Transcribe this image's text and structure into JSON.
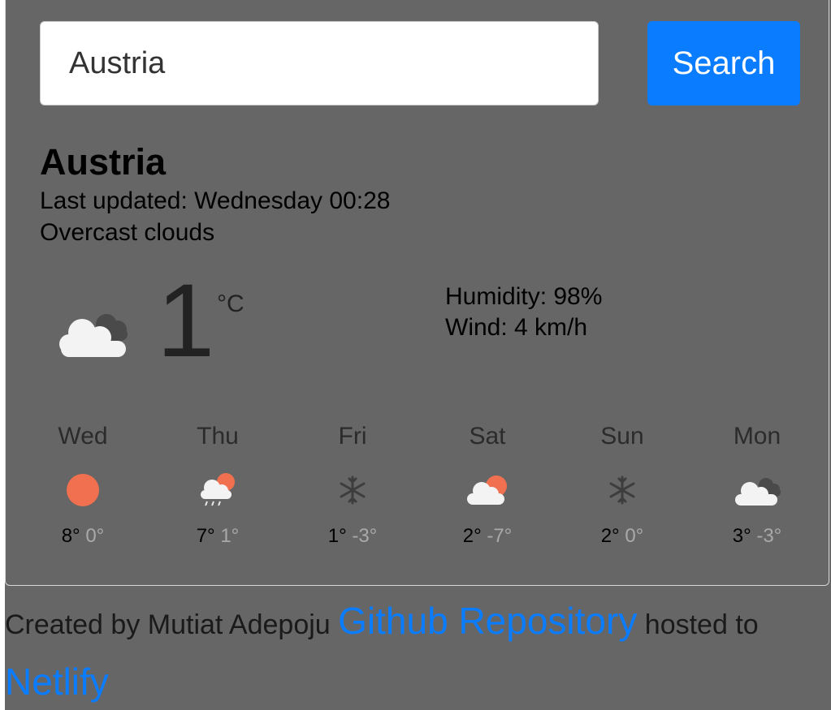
{
  "search": {
    "value": "Austria",
    "button_label": "Search"
  },
  "current": {
    "city": "Austria",
    "updated": "Last updated: Wednesday 00:28",
    "description": "Overcast clouds",
    "temperature": "1",
    "unit": "°C",
    "humidity": "Humidity: 98%",
    "wind": "Wind: 4 km/h",
    "icon": "overcast-cloud-icon"
  },
  "forecast": [
    {
      "day": "Wed",
      "max": "8°",
      "min": "0°",
      "icon": "sun-icon"
    },
    {
      "day": "Thu",
      "max": "7°",
      "min": "1°",
      "icon": "rain-cloud-sun-icon"
    },
    {
      "day": "Fri",
      "max": "1°",
      "min": "-3°",
      "icon": "snowflake-icon"
    },
    {
      "day": "Sat",
      "max": "2°",
      "min": "-7°",
      "icon": "cloud-sun-icon"
    },
    {
      "day": "Sun",
      "max": "2°",
      "min": "0°",
      "icon": "snowflake-icon"
    },
    {
      "day": "Mon",
      "max": "3°",
      "min": "-3°",
      "icon": "overcast-cloud-icon"
    }
  ],
  "footer": {
    "prefix": "Created by Mutiat Adepoju",
    "repo_link": "Github Repository",
    "middle": "hosted to",
    "host_link": "Netlify"
  },
  "colors": {
    "background": "#666666",
    "accent": "#0a7cff",
    "sun": "#f0704f",
    "cloud": "#f3f3f3",
    "dark_cloud": "#4a4a4a"
  }
}
